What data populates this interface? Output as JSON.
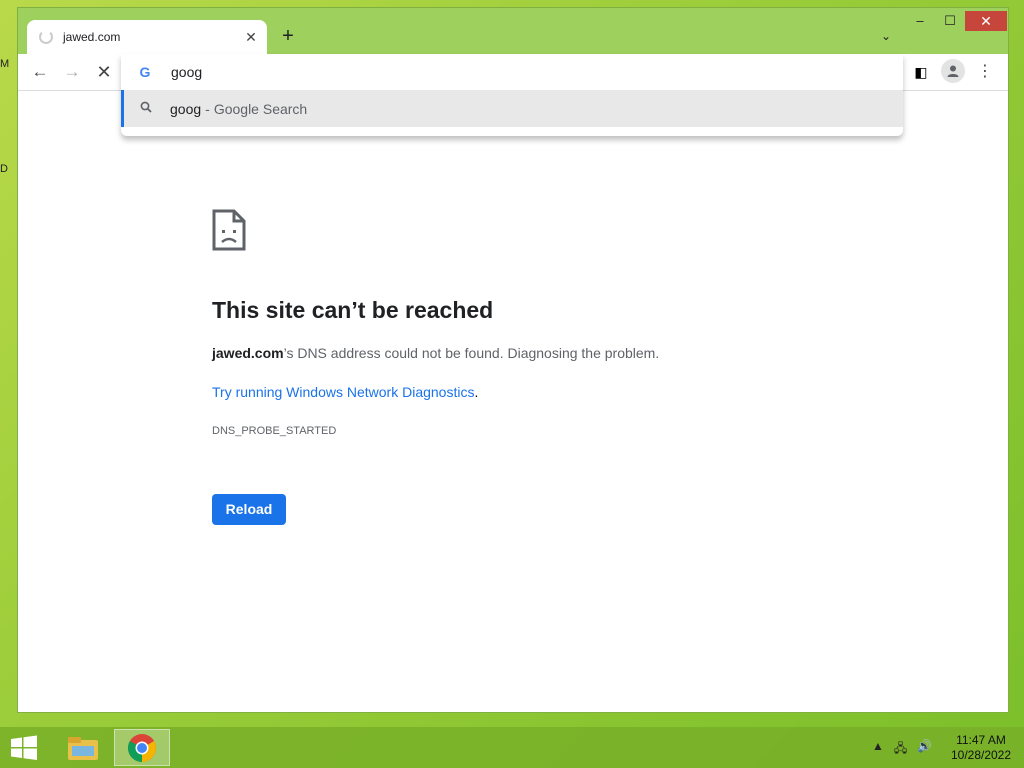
{
  "desktop": {
    "edge_letters": [
      "M",
      "D"
    ]
  },
  "browser": {
    "tab": {
      "title": "jawed.com"
    },
    "new_tab_symbol": "+",
    "omnibox": {
      "text": "goog"
    },
    "suggestion": {
      "query": "goog",
      "separator": "-",
      "source": "Google Search"
    }
  },
  "error_page": {
    "title": "This site can’t be reached",
    "domain": "jawed.com",
    "description": "’s DNS address could not be found. Diagnosing the problem.",
    "link_text": "Try running Windows Network Diagnostics",
    "link_suffix": ".",
    "error_code": "DNS_PROBE_STARTED",
    "reload_label": "Reload"
  },
  "taskbar": {
    "time": "11:47 AM",
    "date": "10/28/2022",
    "apps": [
      "file-explorer-icon",
      "chrome-icon"
    ]
  },
  "colors": {
    "accent": "#1a73e8",
    "close_button": "#c7463c",
    "desktop": "#9ccd3a"
  }
}
